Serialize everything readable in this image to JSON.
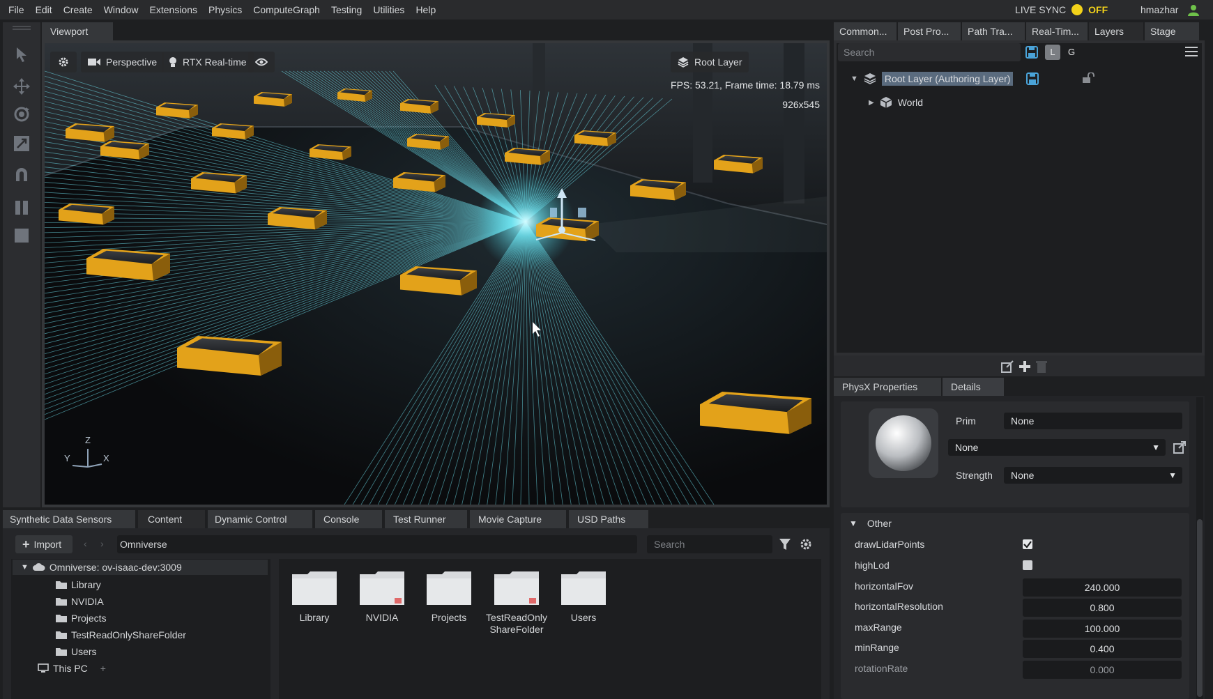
{
  "menu": [
    "File",
    "Edit",
    "Create",
    "Window",
    "Extensions",
    "Physics",
    "ComputeGraph",
    "Testing",
    "Utilities",
    "Help"
  ],
  "live_sync": {
    "label": "LIVE SYNC",
    "state": "OFF"
  },
  "user": {
    "name": "hmazhar"
  },
  "viewport": {
    "tab": "Viewport",
    "camera": "Perspective",
    "renderer": "RTX Real-time",
    "layer": "Root Layer",
    "fps": "FPS: 53.21, Frame time: 18.79 ms",
    "resolution": "926x545",
    "axes": {
      "z": "Z",
      "y": "Y",
      "x": "X"
    }
  },
  "right_tabs": [
    "Common...",
    "Post Pro...",
    "Path Tra...",
    "Real-Tim...",
    "Layers",
    "Stage"
  ],
  "layers": {
    "search_placeholder": "Search",
    "btn_l": "L",
    "btn_g": "G",
    "root": "Root Layer (Authoring Layer)",
    "child": "World"
  },
  "props_tabs": [
    "PhysX Properties",
    "Details"
  ],
  "material": {
    "prim_label": "Prim",
    "prim_value": "None",
    "select_value": "None",
    "strength_label": "Strength",
    "strength_value": "None"
  },
  "other": {
    "section": "Other",
    "fields": [
      {
        "label": "drawLidarPoints",
        "kind": "checkbox",
        "checked": true
      },
      {
        "label": "highLod",
        "kind": "checkbox",
        "checked": false
      },
      {
        "label": "horizontalFov",
        "kind": "number",
        "value": "240.000"
      },
      {
        "label": "horizontalResolution",
        "kind": "number",
        "value": "0.800"
      },
      {
        "label": "maxRange",
        "kind": "number",
        "value": "100.000"
      },
      {
        "label": "minRange",
        "kind": "number",
        "value": "0.400"
      },
      {
        "label": "rotationRate",
        "kind": "number",
        "value": "0.000"
      }
    ]
  },
  "bottom_tabs": [
    "Synthetic Data Sensors",
    "Content",
    "Dynamic Control",
    "Console",
    "Test Runner",
    "Movie Capture",
    "USD Paths"
  ],
  "content": {
    "import_label": "Import",
    "path": "Omniverse",
    "search_placeholder": "Search",
    "server": "Omniverse: ov-isaac-dev:3009",
    "tree": [
      "Library",
      "NVIDIA",
      "Projects",
      "TestReadOnlyShareFolder",
      "Users"
    ],
    "this_pc": "This PC",
    "folders": [
      {
        "name": "Library",
        "locked": false
      },
      {
        "name": "NVIDIA",
        "locked": true
      },
      {
        "name": "Projects",
        "locked": false
      },
      {
        "name": "TestReadOnly ShareFolder",
        "locked": true
      },
      {
        "name": "Users",
        "locked": false
      }
    ]
  },
  "colors": {
    "accent_yellow": "#f2d21a",
    "lidar": "#6fe3f0",
    "robot": "#e3a21a",
    "selection": "#5a6b7e"
  }
}
